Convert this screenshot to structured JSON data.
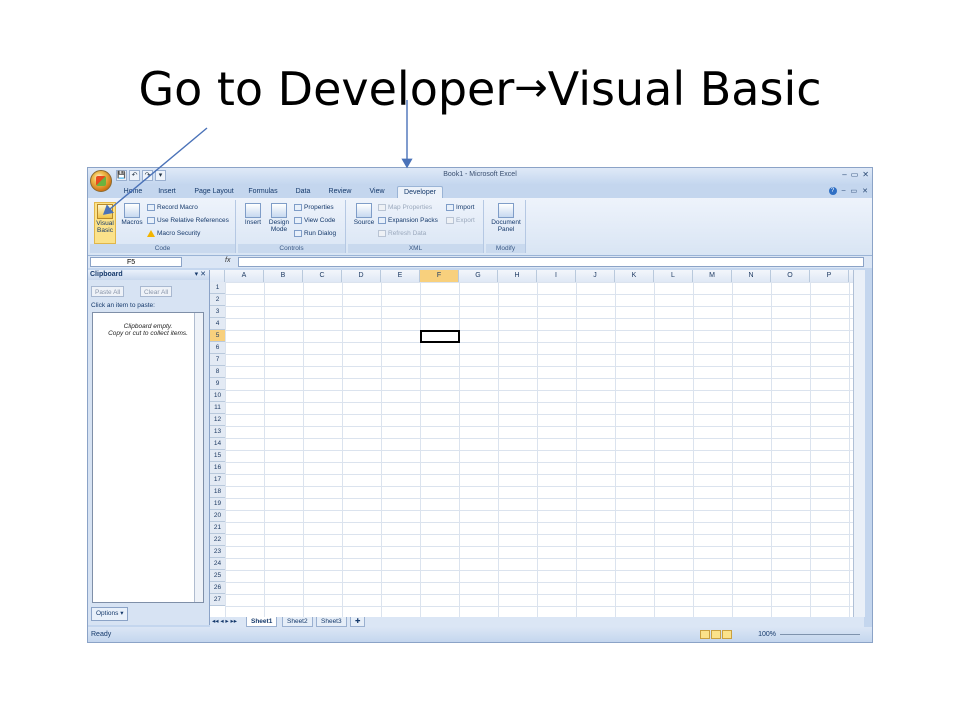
{
  "slide": {
    "title_before": "Go to Developer",
    "title_arrow": "→",
    "title_after": "Visual Basic"
  },
  "window": {
    "title": "Book1 - Microsoft Excel",
    "controls": [
      "–",
      "▭",
      "✕"
    ],
    "doc_controls": [
      "–",
      "▭",
      "✕"
    ]
  },
  "qat": {
    "save": "💾",
    "undo": "↶",
    "redo": "↷",
    "more": "▾"
  },
  "tabs": [
    "Home",
    "Insert",
    "Page Layout",
    "Formulas",
    "Data",
    "Review",
    "View",
    "Developer"
  ],
  "active_tab": "Developer",
  "ribbon": {
    "code": {
      "label": "Code",
      "visual_basic": "Visual Basic",
      "macros": "Macros",
      "record_macro": "Record Macro",
      "use_relative": "Use Relative References",
      "macro_security": "Macro Security"
    },
    "controls": {
      "label": "Controls",
      "insert": "Insert",
      "design_mode": "Design Mode",
      "properties": "Properties",
      "view_code": "View Code",
      "run_dialog": "Run Dialog"
    },
    "xml": {
      "label": "XML",
      "source": "Source",
      "map_properties": "Map Properties",
      "expansion_packs": "Expansion Packs",
      "refresh_data": "Refresh Data",
      "import": "Import",
      "export": "Export"
    },
    "modify": {
      "label": "Modify",
      "document_panel": "Document Panel"
    }
  },
  "formula_bar": {
    "name_box": "F5",
    "fx": "fx",
    "value": ""
  },
  "clipboard": {
    "title": "Clipboard",
    "paste_all": "Paste All",
    "clear_all": "Clear All",
    "hint": "Click an item to paste:",
    "empty_line1": "Clipboard empty.",
    "empty_line2": "Copy or cut to collect items.",
    "options": "Options ▾"
  },
  "grid": {
    "columns": [
      "A",
      "B",
      "C",
      "D",
      "E",
      "F",
      "G",
      "H",
      "I",
      "J",
      "K",
      "L",
      "M",
      "N",
      "O",
      "P"
    ],
    "rows": [
      "1",
      "2",
      "3",
      "4",
      "5",
      "6",
      "7",
      "8",
      "9",
      "10",
      "11",
      "12",
      "13",
      "14",
      "15",
      "16",
      "17",
      "18",
      "19",
      "20",
      "21",
      "22",
      "23",
      "24",
      "25",
      "26",
      "27"
    ],
    "selected_column": "F",
    "selected_row": "5"
  },
  "sheets": [
    "Sheet1",
    "Sheet2",
    "Sheet3"
  ],
  "active_sheet": "Sheet1",
  "status": {
    "text": "Ready",
    "zoom": "100%"
  }
}
